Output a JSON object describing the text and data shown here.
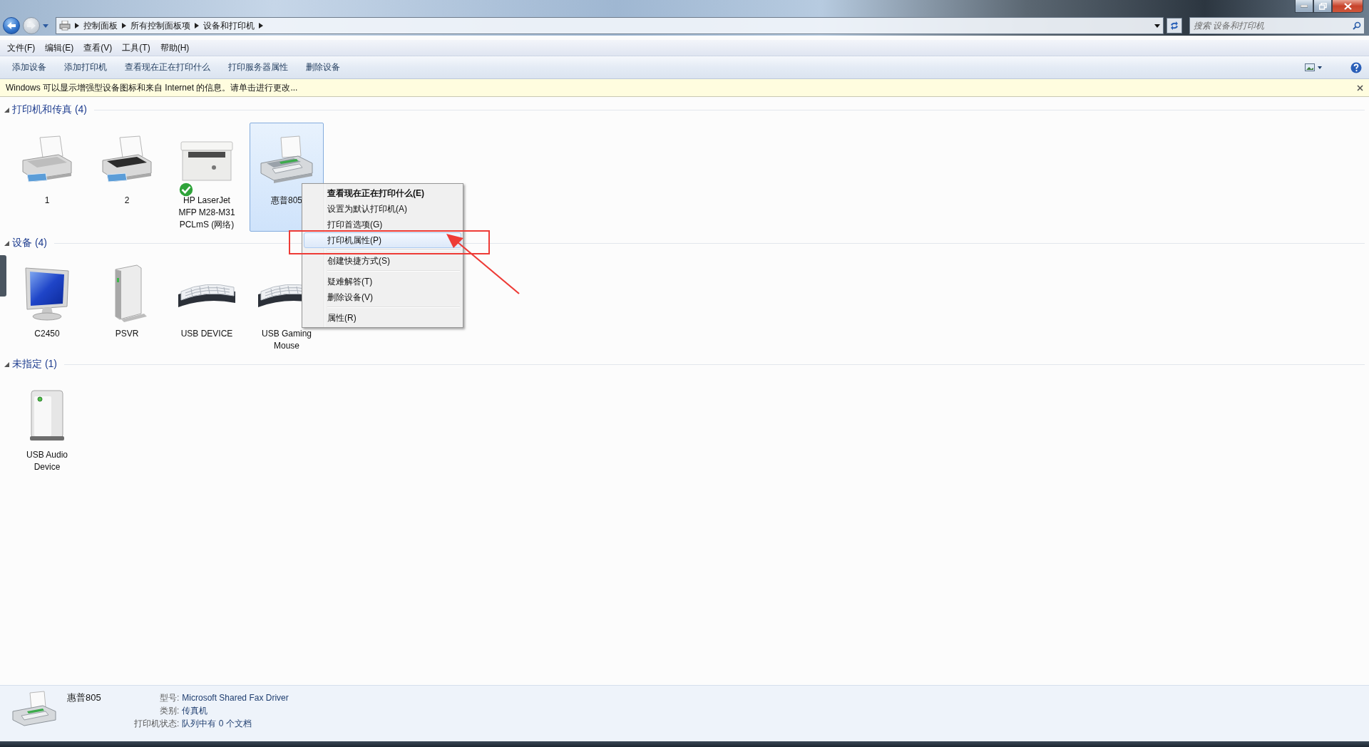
{
  "address_bar": {
    "breadcrumbs": [
      "控制面板",
      "所有控制面板项",
      "设备和打印机"
    ]
  },
  "search": {
    "placeholder": "搜索 设备和打印机"
  },
  "menu_bar": [
    "文件(F)",
    "编辑(E)",
    "查看(V)",
    "工具(T)",
    "帮助(H)"
  ],
  "toolbar": [
    "添加设备",
    "添加打印机",
    "查看现在正在打印什么",
    "打印服务器属性",
    "删除设备"
  ],
  "info_bar": {
    "text": "Windows 可以显示增强型设备图标和来自 Internet 的信息。请单击进行更改..."
  },
  "groups": [
    {
      "title": "打印机和传真 (4)",
      "expanded": true,
      "items": [
        {
          "label": "1",
          "kind": "printer",
          "selected": false,
          "default": false
        },
        {
          "label": "2",
          "kind": "inkjet",
          "selected": false,
          "default": false
        },
        {
          "label": "HP LaserJet MFP M28-M31 PCLmS (网络)",
          "kind": "mfp",
          "selected": false,
          "default": true
        },
        {
          "label": "惠普805",
          "kind": "fax",
          "selected": true,
          "default": false
        }
      ]
    },
    {
      "title": "设备 (4)",
      "expanded": true,
      "items": [
        {
          "label": "C2450",
          "kind": "monitor",
          "selected": false,
          "default": false
        },
        {
          "label": "PSVR",
          "kind": "tower",
          "selected": false,
          "default": false
        },
        {
          "label": "USB DEVICE",
          "kind": "keyboard",
          "selected": false,
          "default": false
        },
        {
          "label": "USB Gaming Mouse",
          "kind": "keyboard",
          "selected": false,
          "default": false
        }
      ]
    },
    {
      "title": "未指定 (1)",
      "expanded": true,
      "items": [
        {
          "label": "USB Audio Device",
          "kind": "box",
          "selected": false,
          "default": false
        }
      ]
    }
  ],
  "context_menu": {
    "items": [
      {
        "kind": "item",
        "label": "查看现在正在打印什么(E)",
        "bold": true,
        "selected": false
      },
      {
        "kind": "item",
        "label": "设置为默认打印机(A)",
        "bold": false,
        "selected": false
      },
      {
        "kind": "item",
        "label": "打印首选项(G)",
        "bold": false,
        "selected": false
      },
      {
        "kind": "item",
        "label": "打印机属性(P)",
        "bold": false,
        "selected": true
      },
      {
        "kind": "separator"
      },
      {
        "kind": "item",
        "label": "创建快捷方式(S)",
        "bold": false,
        "selected": false
      },
      {
        "kind": "separator"
      },
      {
        "kind": "item",
        "label": "疑难解答(T)",
        "bold": false,
        "selected": false
      },
      {
        "kind": "item",
        "label": "删除设备(V)",
        "bold": false,
        "selected": false
      },
      {
        "kind": "separator"
      },
      {
        "kind": "item",
        "label": "属性(R)",
        "bold": false,
        "selected": false
      }
    ]
  },
  "details": {
    "name": "惠普805",
    "fields": [
      {
        "label": "型号:",
        "value": "Microsoft Shared Fax Driver"
      },
      {
        "label": "类别:",
        "value": "传真机"
      },
      {
        "label": "打印机状态:",
        "value": "队列中有 0 个文档"
      }
    ]
  }
}
